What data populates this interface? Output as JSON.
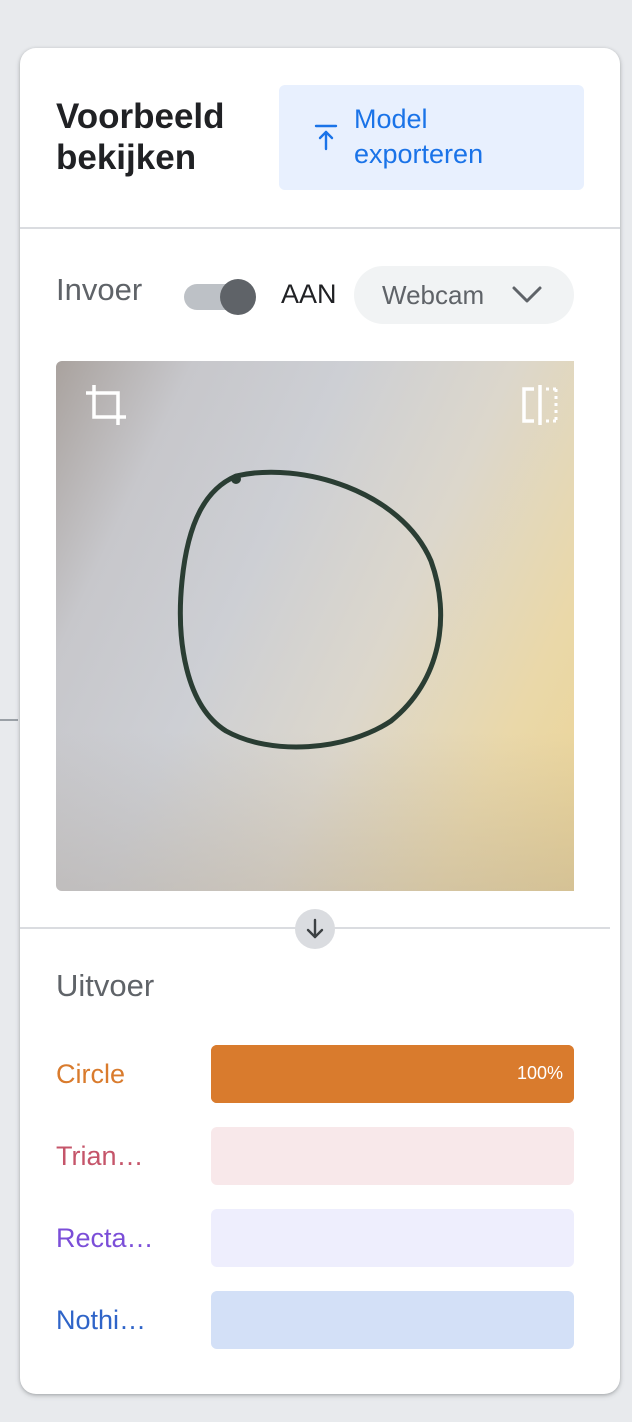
{
  "header": {
    "title_line1": "Voorbeeld",
    "title_line2": "bekijken",
    "export_label_line1": "Model",
    "export_label_line2": "exporteren",
    "export_icon": "upload-icon"
  },
  "input": {
    "label": "Invoer",
    "toggle_on": true,
    "toggle_state": "AAN",
    "source": "Webcam"
  },
  "preview": {
    "crop_icon": "crop-icon",
    "flip_icon": "flip-icon"
  },
  "output": {
    "title": "Uitvoer",
    "classes": [
      {
        "label": "Circle",
        "value": 1.0,
        "percent_text": "100%",
        "color": "#d97b2d",
        "track": "#d97b2d"
      },
      {
        "label": "Trian…",
        "value": 0.0,
        "percent_text": "",
        "color": "#c5556a",
        "track": "#f8e8ea"
      },
      {
        "label": "Recta…",
        "value": 0.0,
        "percent_text": "",
        "color": "#7b4ed8",
        "track": "#eeeefd"
      },
      {
        "label": "Nothi…",
        "value": 0.0,
        "percent_text": "",
        "color": "#2f64c8",
        "track": "#d3e0f7"
      }
    ]
  },
  "colors": {
    "accent": "#1a73e8",
    "card_bg": "#ffffff",
    "page_bg": "#e8eaed"
  }
}
